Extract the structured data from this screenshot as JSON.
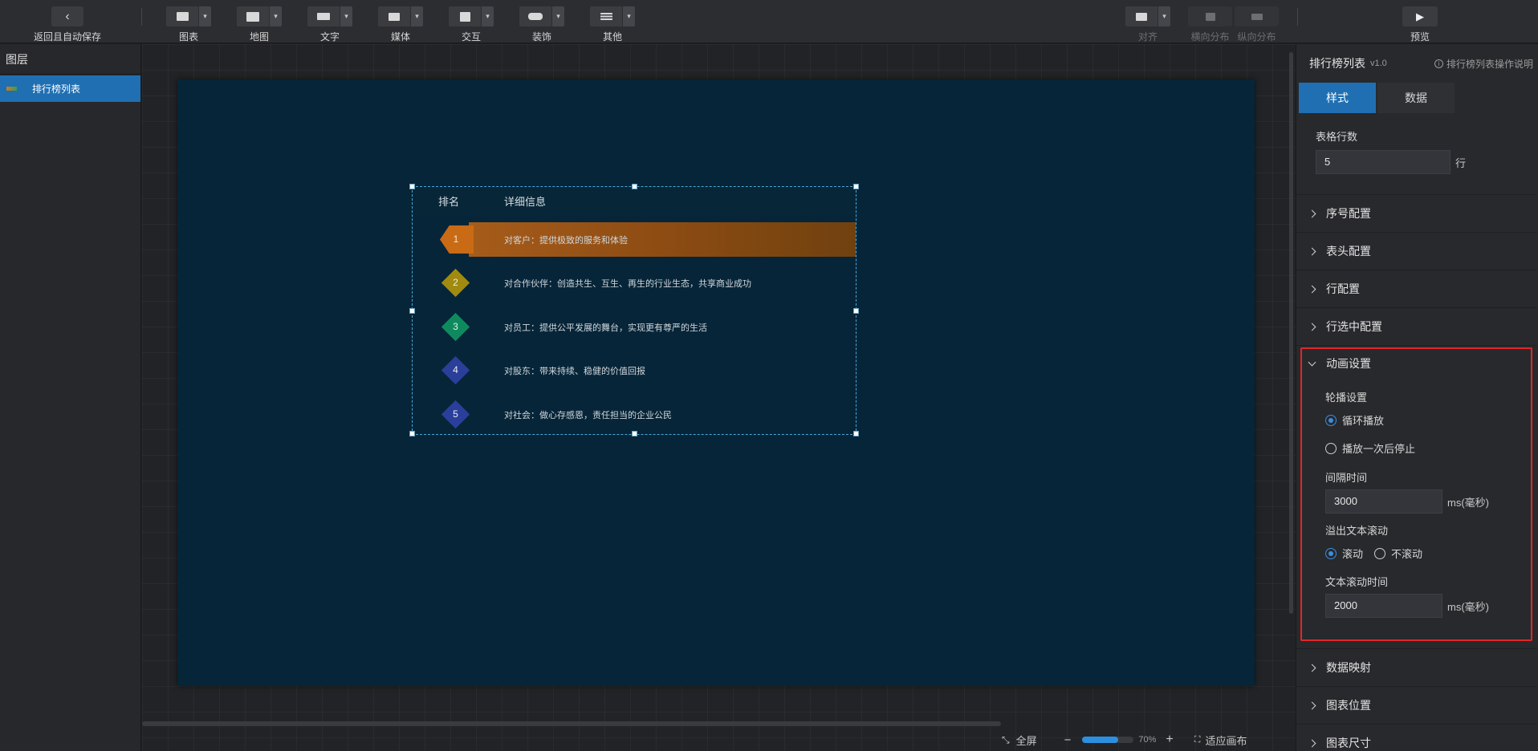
{
  "toolbar": {
    "back_label": "返回且自动保存",
    "groups": [
      {
        "label": "图表"
      },
      {
        "label": "地图"
      },
      {
        "label": "文字"
      },
      {
        "label": "媒体"
      },
      {
        "label": "交互"
      },
      {
        "label": "装饰"
      },
      {
        "label": "其他"
      }
    ],
    "align_label": "对齐",
    "hdist_label": "横向分布",
    "vdist_label": "纵向分布",
    "preview_label": "预览"
  },
  "layers": {
    "title": "图层",
    "items": [
      {
        "label": "排行榜列表"
      }
    ]
  },
  "widget": {
    "header_rank": "排名",
    "header_detail": "详细信息",
    "rows": [
      {
        "rank": "1",
        "text": "对客户：提供极致的服务和体验",
        "color": "#c96a14"
      },
      {
        "rank": "2",
        "text": "对合作伙伴：创造共生、互生、再生的行业生态，共享商业成功",
        "color": "#a08b10"
      },
      {
        "rank": "3",
        "text": "对员工：提供公平发展的舞台，实现更有尊严的生活",
        "color": "#0f8a5f"
      },
      {
        "rank": "4",
        "text": "对股东：带来持续、稳健的价值回报",
        "color": "#2a3f9a"
      },
      {
        "rank": "5",
        "text": "对社会：做心存感恩，责任担当的企业公民",
        "color": "#2a3f9a"
      }
    ]
  },
  "bottom": {
    "fullscreen_label": "全屏",
    "zoom_minus": "−",
    "zoom_value": "70%",
    "zoom_fraction": 0.7,
    "zoom_plus": "+",
    "fit_label": "适应画布"
  },
  "panel": {
    "title": "排行榜列表",
    "version": "v1.0",
    "help": "排行榜列表操作说明",
    "tabs": {
      "style": "样式",
      "data": "数据"
    },
    "rows_label": "表格行数",
    "rows_value": "5",
    "rows_unit": "行",
    "sections_top": [
      "序号配置",
      "表头配置",
      "行配置",
      "行选中配置"
    ],
    "anim": {
      "title": "动画设置",
      "carousel_label": "轮播设置",
      "loop_label": "循环播放",
      "once_label": "播放一次后停止",
      "interval_label": "间隔时间",
      "interval_value": "3000",
      "interval_unit": "ms(毫秒)",
      "overflow_label": "溢出文本滚动",
      "scroll_label": "滚动",
      "noscroll_label": "不滚动",
      "scroll_time_label": "文本滚动时间",
      "scroll_time_value": "2000",
      "scroll_time_unit": "ms(毫秒)"
    },
    "sections_bottom": [
      "数据映射",
      "图表位置",
      "图表尺寸"
    ]
  }
}
